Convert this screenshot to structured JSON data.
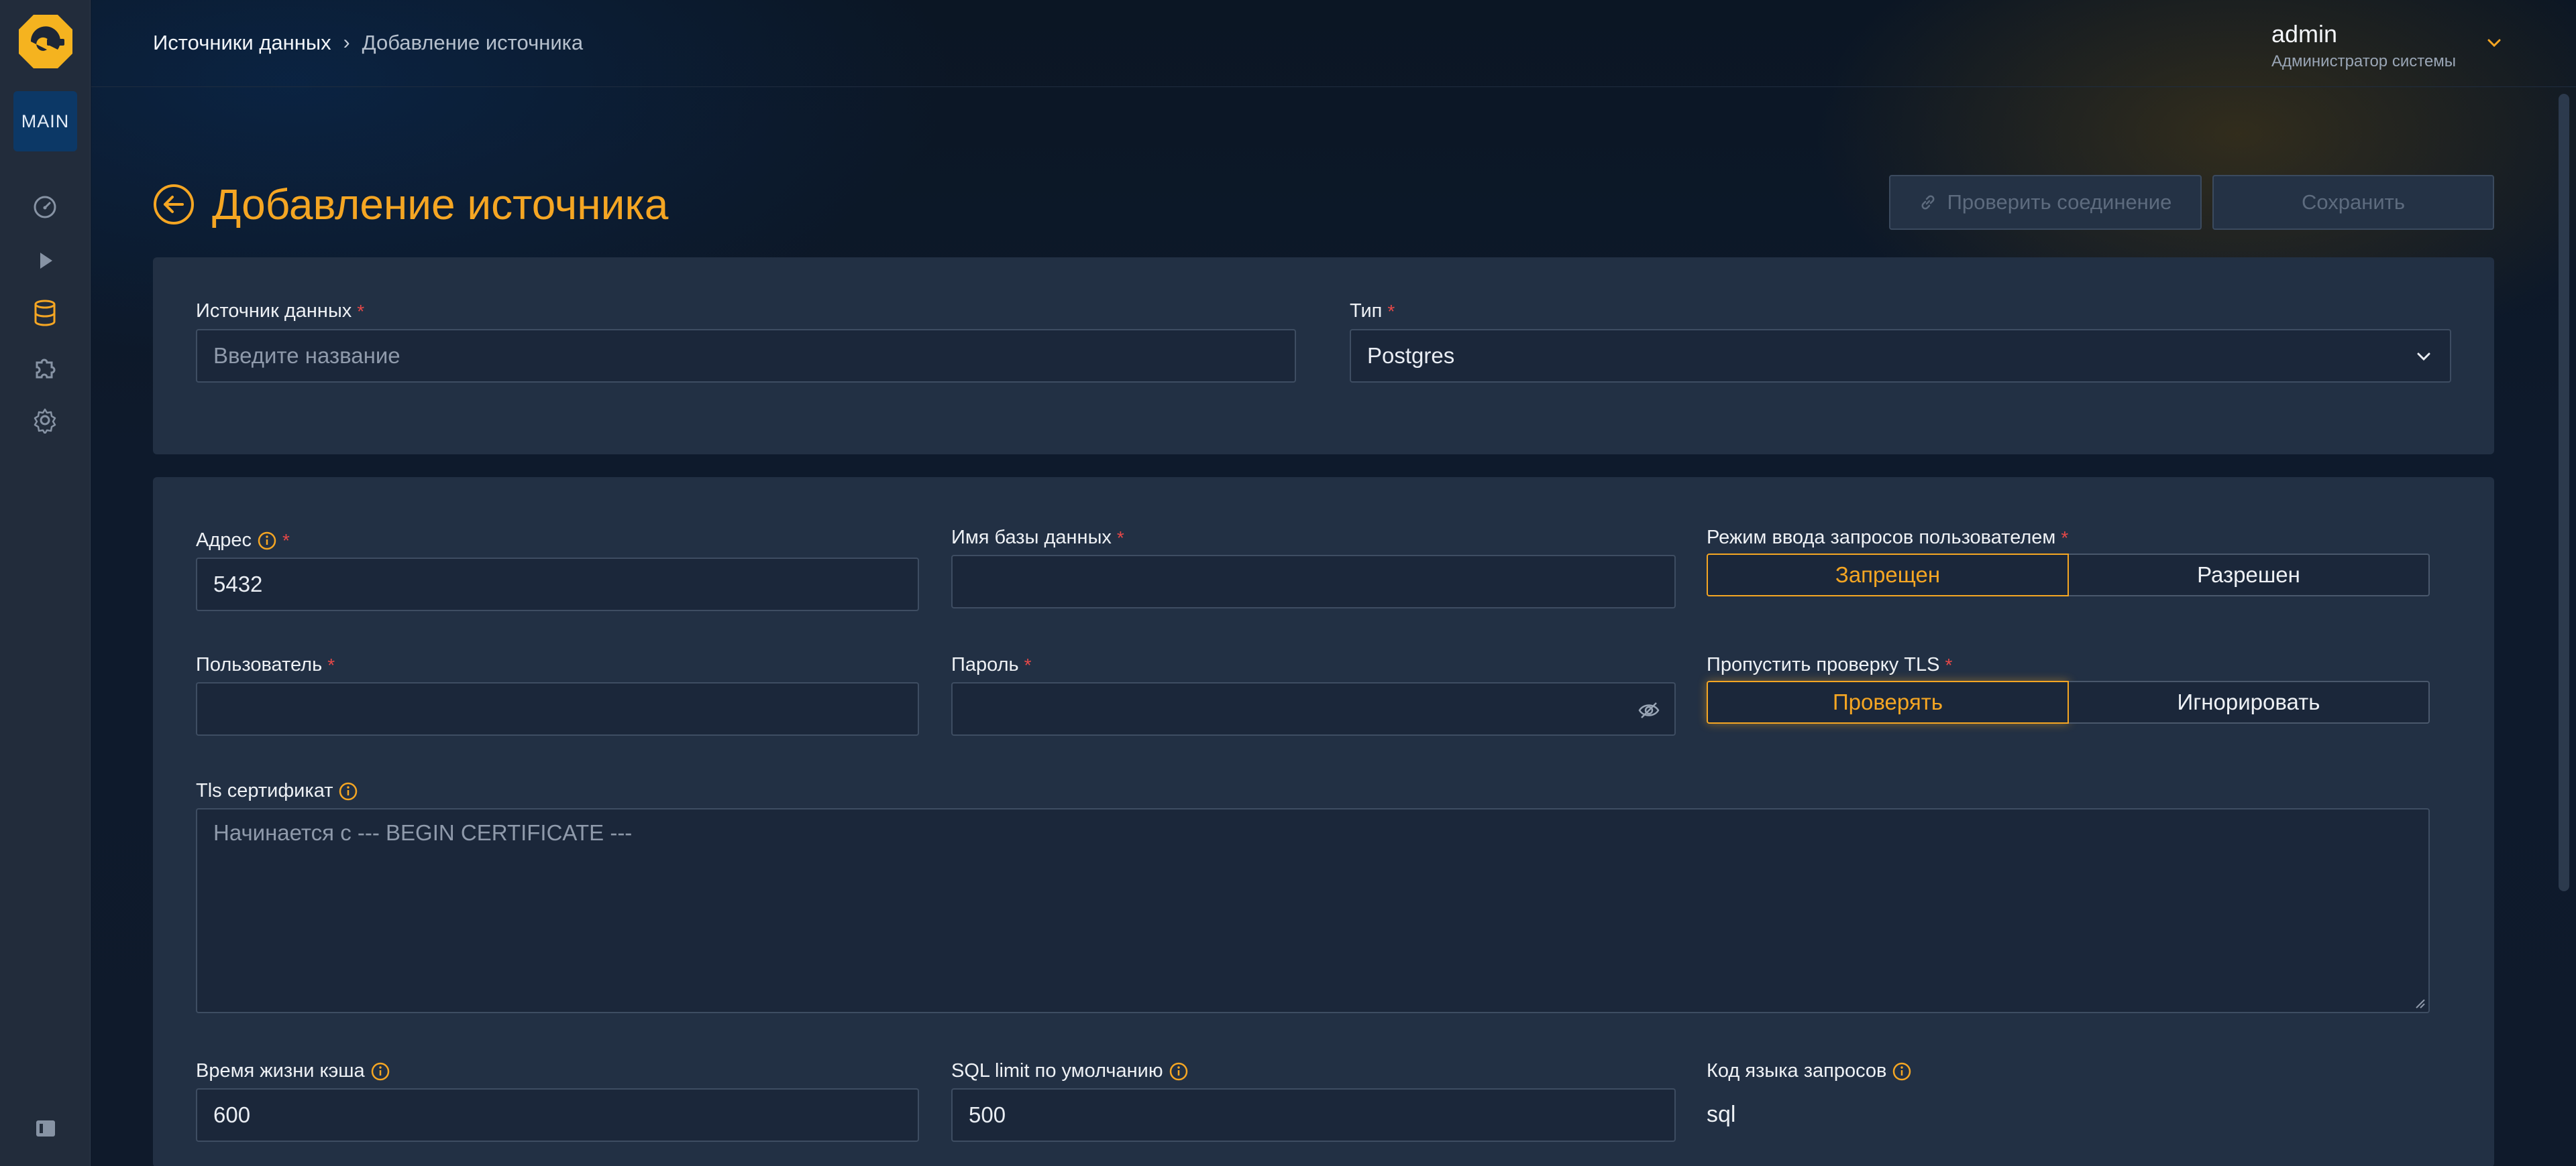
{
  "sidebar": {
    "main_badge": "MAIN",
    "nav_icons": [
      "dashboard-icon",
      "play-icon",
      "database-icon",
      "puzzle-icon",
      "gear-icon"
    ],
    "collapse_icon": "sidebar-collapse-icon"
  },
  "header": {
    "breadcrumb": {
      "parent": "Источники данных",
      "separator": "›",
      "current": "Добавление источника"
    },
    "user": {
      "name": "admin",
      "role": "Администратор системы"
    }
  },
  "page": {
    "title": "Добавление источника",
    "check_connection_label": "Проверить соединение",
    "save_label": "Сохранить"
  },
  "form": {
    "source": {
      "label": "Источник данных",
      "required": "*",
      "placeholder": "Введите название"
    },
    "type": {
      "label": "Тип",
      "required": "*",
      "value": "Postgres"
    },
    "address": {
      "label": "Адрес",
      "required": "*",
      "value": "5432"
    },
    "db_name": {
      "label": "Имя базы данных",
      "required": "*",
      "value": ""
    },
    "query_mode": {
      "label": "Режим ввода запросов пользователем",
      "required": "*",
      "options": [
        "Запрещен",
        "Разрешен"
      ],
      "selected": "Запрещен"
    },
    "user": {
      "label": "Пользователь",
      "required": "*",
      "value": ""
    },
    "password": {
      "label": "Пароль",
      "required": "*",
      "value": ""
    },
    "skip_tls": {
      "label": "Пропустить проверку TLS",
      "required": "*",
      "options": [
        "Проверять",
        "Игнорировать"
      ],
      "selected": "Проверять"
    },
    "tls_cert": {
      "label": "Tls сертификат",
      "placeholder": "Начинается с --- BEGIN CERTIFICATE ---"
    },
    "cache_ttl": {
      "label": "Время жизни кэша",
      "value": "600"
    },
    "sql_limit": {
      "label": "SQL limit по умолчанию",
      "value": "500"
    },
    "query_lang": {
      "label": "Код языка запросов",
      "value": "sql"
    }
  },
  "colors": {
    "accent": "#f5a623",
    "required": "#e54848",
    "brand_blue": "#0c3866"
  }
}
